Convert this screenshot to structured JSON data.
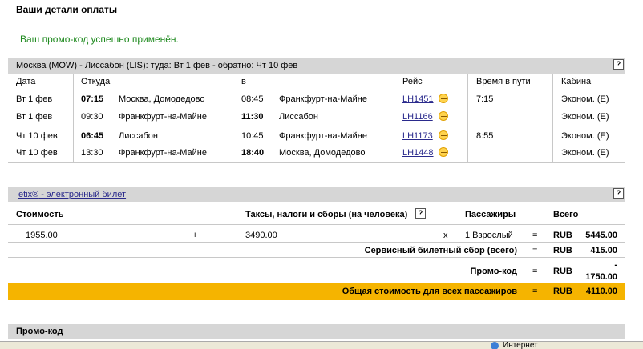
{
  "page": {
    "heading": "Ваши детали оплаты",
    "promo_success": "Ваш промо-код успешно применён.",
    "help_glyph": "?"
  },
  "flights": {
    "route_title": "Москва (MOW) - Лиссабон (LIS): туда: Вт 1 фев - обратно: Чт 10 фев",
    "columns": {
      "date": "Дата",
      "from": "Откуда",
      "to": "в",
      "flight": "Рейс",
      "duration": "Время в пути",
      "cabin": "Кабина"
    },
    "rows": [
      {
        "date": "Вт 1 фев",
        "dep_time": "07:15",
        "dep_place": "Москва, Домодедово",
        "arr_time": "08:45",
        "arr_place": "Франкфурт-на-Майне",
        "flight": "LH1451",
        "duration": "7:15",
        "cabin": "Эконом. (E)"
      },
      {
        "date": "Вт 1 фев",
        "dep_time": "09:30",
        "dep_place": "Франкфурт-на-Майне",
        "arr_time": "11:30",
        "arr_place": "Лиссабон",
        "flight": "LH1166",
        "duration": "",
        "cabin": "Эконом. (E)"
      },
      {
        "date": "Чт 10 фев",
        "dep_time": "06:45",
        "dep_place": "Лиссабон",
        "arr_time": "10:45",
        "arr_place": "Франкфурт-на-Майне",
        "flight": "LH1173",
        "duration": "8:55",
        "cabin": "Эконом. (E)"
      },
      {
        "date": "Чт 10 фев",
        "dep_time": "13:30",
        "dep_place": "Франкфурт-на-Майне",
        "arr_time": "18:40",
        "arr_place": "Москва, Домодедово",
        "flight": "LH1448",
        "duration": "",
        "cabin": "Эконом. (E)"
      }
    ]
  },
  "pricing": {
    "etix_link": "etix®",
    "etix_suffix": " - электронный билет",
    "col_cost": "Стоимость",
    "col_taxes": "Таксы, налоги и сборы (на человека)",
    "col_passengers": "Пассажиры",
    "col_total": "Всего",
    "fare": "1955.00",
    "plus": "+",
    "taxes": "3490.00",
    "times": "x",
    "passengers": "1 Взрослый",
    "eq": "=",
    "currency": "RUB",
    "fare_total": "5445.00",
    "service_fee_label": "Сервисный билетный сбор (всего)",
    "service_fee": "415.00",
    "promo_label": "Промо-код",
    "promo_minus": "-",
    "promo_value": "1750.00",
    "grand_total_label": "Общая стоимость для всех пассажиров",
    "grand_total": "4110.00"
  },
  "promo_section": {
    "title": "Промо-код"
  },
  "statusbar": {
    "zone": "Интернет"
  }
}
